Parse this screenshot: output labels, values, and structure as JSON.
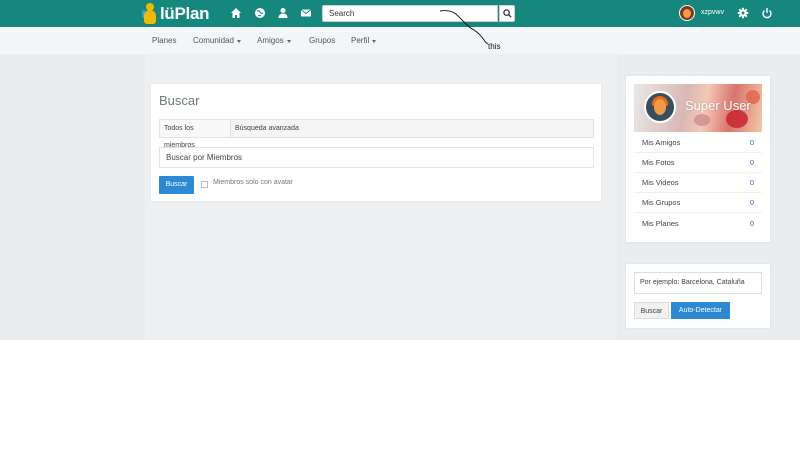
{
  "brand": {
    "name": "lüPlan",
    "accent": "#16877d"
  },
  "topnav": {
    "icons": [
      "home-icon",
      "globe-icon",
      "user-icon",
      "mail-icon"
    ],
    "search": {
      "placeholder": "Search",
      "value": "Search"
    },
    "user": {
      "name": "xzpvwv"
    }
  },
  "subnav": {
    "items": [
      {
        "label": "Planes"
      },
      {
        "label": "Comunidad"
      },
      {
        "label": "Amigos"
      },
      {
        "label": "Grupos"
      },
      {
        "label": "Perfil"
      }
    ]
  },
  "main": {
    "title": "Buscar",
    "tabs": [
      {
        "label": "Todos los miembros"
      },
      {
        "label": "Búsqueda avanzada"
      }
    ],
    "search_field": "Buscar por Miembros",
    "submit_label": "Buscar",
    "checkbox_label": "Miembros solo con avatar"
  },
  "profile": {
    "name": "Super User",
    "stats": [
      {
        "label": "Mis Amigos",
        "value": "0"
      },
      {
        "label": "Mis Fotos",
        "value": "0"
      },
      {
        "label": "Mis Videos",
        "value": "0"
      },
      {
        "label": "Mis Grupos",
        "value": "0"
      },
      {
        "label": "Mis Planes",
        "value": "0"
      }
    ]
  },
  "location": {
    "value": "Por ejemplo: Barcelona, Cataluña",
    "search_label": "Buscar",
    "auto_label": "Auto-Detectar"
  },
  "annotation": {
    "text": "this"
  }
}
